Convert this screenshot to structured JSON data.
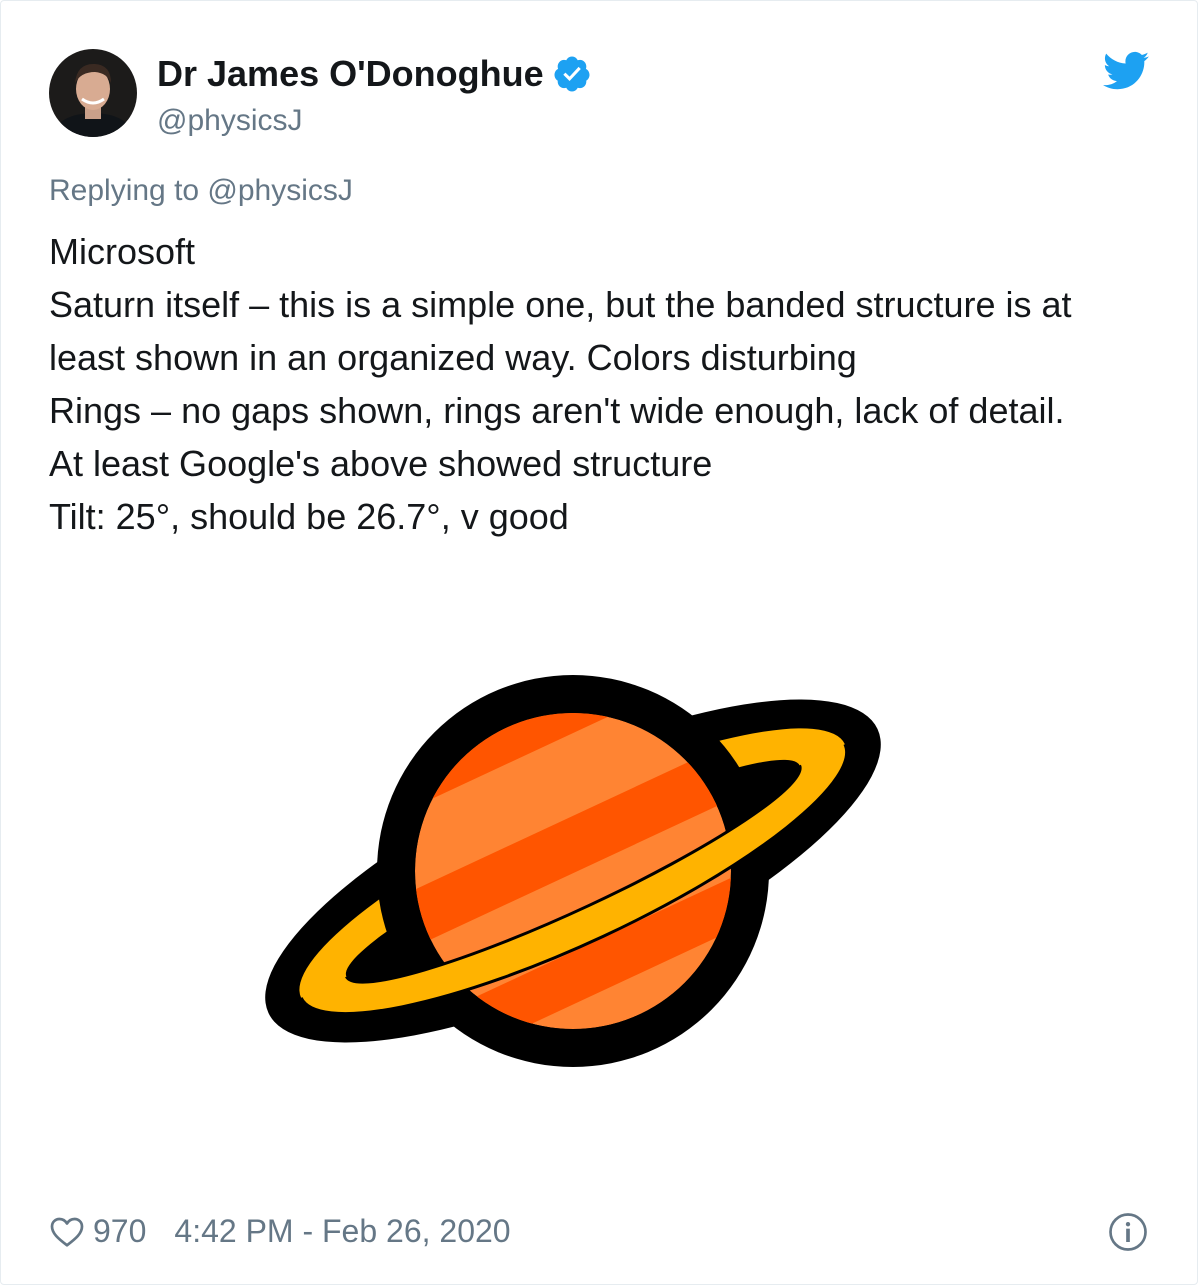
{
  "tweet": {
    "author": {
      "display_name": "Dr James O'Donoghue",
      "handle": "@physicsJ",
      "verified": true
    },
    "replying_to": "Replying to @physicsJ",
    "body_lines": [
      "Microsoft",
      "Saturn itself – this is a simple one, but the banded structure is at",
      "least shown in an organized way. Colors disturbing",
      "Rings –  no gaps shown, rings aren't wide enough, lack of detail.",
      "At least Google's above showed structure",
      "Tilt: 25°, should be 26.7°, v good"
    ],
    "media": {
      "icons": [
        "saturn-emoji-image"
      ],
      "colors": {
        "planet_light": "#FF8433",
        "planet_band": "#FF5500",
        "ring": "#FFB300",
        "outline": "#000000"
      }
    },
    "footer": {
      "like_count": "970",
      "timestamp": "4:42 PM - Feb 26, 2020"
    }
  },
  "icons": [
    "verified-badge-icon",
    "twitter-bird-icon",
    "heart-icon",
    "info-icon"
  ],
  "colors": {
    "brand_blue": "#1DA1F2",
    "secondary_text": "#657786",
    "primary_text": "#14171A"
  }
}
